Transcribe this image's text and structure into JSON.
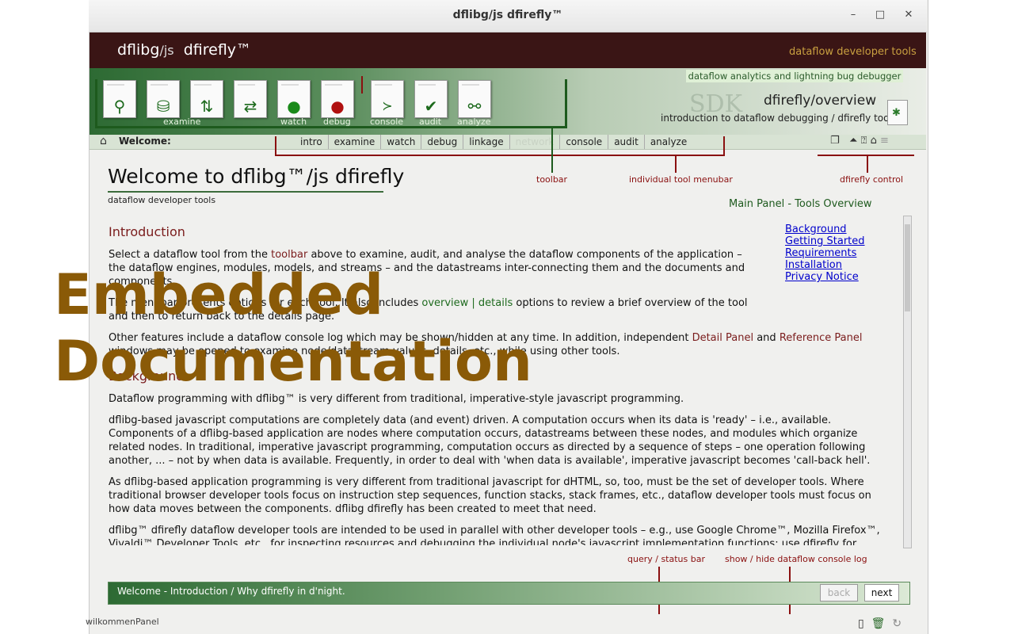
{
  "window": {
    "title": "dflibg/js dfirefly™",
    "min": "–",
    "max": "□",
    "close": "✕"
  },
  "header": {
    "logo_main": "dflibg",
    "logo_js": "/js",
    "logo_product": "dfirefly™",
    "tagline": "dataflow developer tools",
    "analytics": "dataflow analytics and lightning bug debugger"
  },
  "tools": [
    {
      "icon": "magnifier-icon",
      "glyph": "🔍"
    },
    {
      "icon": "database-icon",
      "glyph": "⛁"
    },
    {
      "icon": "transform-icon",
      "glyph": "⇅"
    },
    {
      "icon": "refresh-icon",
      "glyph": "⇄"
    },
    {
      "icon": "watch-icon",
      "glyph": "●",
      "label": "watch"
    },
    {
      "icon": "debug-icon",
      "glyph": "●",
      "label": "debug"
    },
    {
      "icon": "console-icon",
      "glyph": "≻",
      "label": "console"
    },
    {
      "icon": "audit-icon",
      "glyph": "✔",
      "label": "audit"
    },
    {
      "icon": "analyze-icon",
      "glyph": "⚲",
      "label": "analyze"
    }
  ],
  "examine_label": "examine",
  "overview": {
    "title": "dfirefly/overview",
    "subtitle": "introduction to dataflow debugging / dfirefly tools",
    "watermark": "SDK"
  },
  "welcome_bar": {
    "label": "Welcome:"
  },
  "menu": [
    "intro",
    "examine",
    "watch",
    "debug",
    "linkage",
    "network",
    "console",
    "audit",
    "analyze"
  ],
  "annotations": {
    "toolbar": "toolbar",
    "menubar": "individual  tool  menubar",
    "control": "dfirefly  control",
    "status": "query / status bar",
    "console": "show / hide dataflow console log"
  },
  "main": {
    "title_pre": "Welcome to ",
    "title_brand": "dflibg™/js  dfirefly",
    "subtitle": "dataflow developer tools",
    "panel_label": "Main Panel - Tools Overview",
    "links": [
      "Background",
      "Getting Started",
      "Requirements",
      "Installation",
      "Privacy Notice"
    ],
    "intro_heading": "Introduction",
    "p1a": "Select a dataflow tool from the ",
    "p1b": "toolbar",
    "p1c": " above to examine, audit, and analyse the dataflow components of the application – the dataflow engines, modules, models, and streams – and the datastreams inter-connecting them and the documents and components.",
    "p2a": "The menubar presents options for each tool. It also includes ",
    "p2b": "overview | details",
    "p2c": " options to review a brief overview of the tool and then to return back to the details page.",
    "p3a": "Other features include a dataflow console log which may be shown/hidden at any time. In addition, independent ",
    "p3b": "Detail Panel",
    "p3c": " and ",
    "p3d": "Reference Panel",
    "p3e": " windows may be opened to examine node/datastream values, details, etc., while using other tools.",
    "bg_heading": "Background",
    "p4": "Dataflow programming with dflibg™ is very different from traditional, imperative-style javascript programming.",
    "p5": "dflibg-based javascript computations are completely data (and event) driven. A computation occurs when its data is 'ready' – i.e., available. Components of a dflibg-based application are nodes where computation occurs, datastreams between these nodes, and modules which organize related nodes. In traditional, imperative javascript programming, computation occurs as directed by a sequence of steps – one operation following another, ... – not by when data is available. Frequently, in order to deal with 'when data is available', imperative javascript becomes 'call-back hell'.",
    "p6": "As dflibg-based application programming is very different from traditional javascript for dHTML, so, too, must be the set of developer tools. Where traditional browser developer tools focus on instruction step sequences, function stacks, stack frames, etc., dataflow developer tools must focus on how data moves between the components. dflibg dfirefly has been created to meet that need.",
    "p7": "dflibg™ dfirefly dataflow developer tools are intended to be used in parallel with other developer tools – e.g., use Google Chrome™, Mozilla Firefox™, Vivaldi™ Developer Tools, etc., for inspecting resources and debugging the individual node's javascript implementation functions; use dfirefly for inspecting"
  },
  "overlay": {
    "line1": "Embedded",
    "line2": "Documentation"
  },
  "status": {
    "text": "Welcome - Introduction / Why dfirefly in d'night.",
    "back": "back",
    "next": "next"
  },
  "footer": {
    "panel": "wilkommenPanel"
  },
  "colors": {
    "header": "#3a1515",
    "accent_green": "#1d5a1d",
    "link": "#0000cc",
    "annotation": "#8a1010"
  }
}
